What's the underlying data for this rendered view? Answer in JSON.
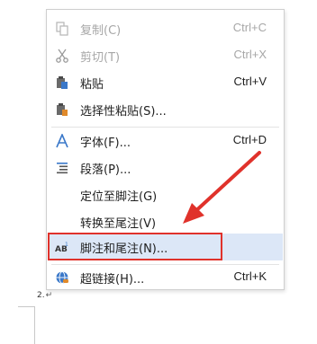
{
  "menu": {
    "items": [
      {
        "label": "复制(C)",
        "shortcut": "Ctrl+C",
        "icon": "copy-icon",
        "disabled": true
      },
      {
        "label": "剪切(T)",
        "shortcut": "Ctrl+X",
        "icon": "scissors-icon",
        "disabled": true
      },
      {
        "label": "粘贴",
        "shortcut": "Ctrl+V",
        "icon": "paste-icon",
        "disabled": false
      },
      {
        "label": "选择性粘贴(S)...",
        "shortcut": "",
        "icon": "paste-special-icon",
        "disabled": false
      },
      {
        "label": "字体(F)...",
        "shortcut": "Ctrl+D",
        "icon": "font-icon",
        "disabled": false
      },
      {
        "label": "段落(P)...",
        "shortcut": "",
        "icon": "paragraph-icon",
        "disabled": false
      },
      {
        "label": "定位至脚注(G)",
        "shortcut": "",
        "icon": "",
        "disabled": false
      },
      {
        "label": "转换至尾注(V)",
        "shortcut": "",
        "icon": "",
        "disabled": false
      },
      {
        "label": "脚注和尾注(N)...",
        "shortcut": "",
        "icon": "footnote-icon",
        "disabled": false,
        "highlighted": true
      },
      {
        "label": "超链接(H)...",
        "shortcut": "Ctrl+K",
        "icon": "hyperlink-icon",
        "disabled": false
      }
    ]
  },
  "document": {
    "footnote_number": "2.",
    "paragraph_mark": "↵"
  },
  "colors": {
    "highlight": "#dce7f7",
    "callout": "#e0322b",
    "icon_blue": "#3a78c9"
  }
}
